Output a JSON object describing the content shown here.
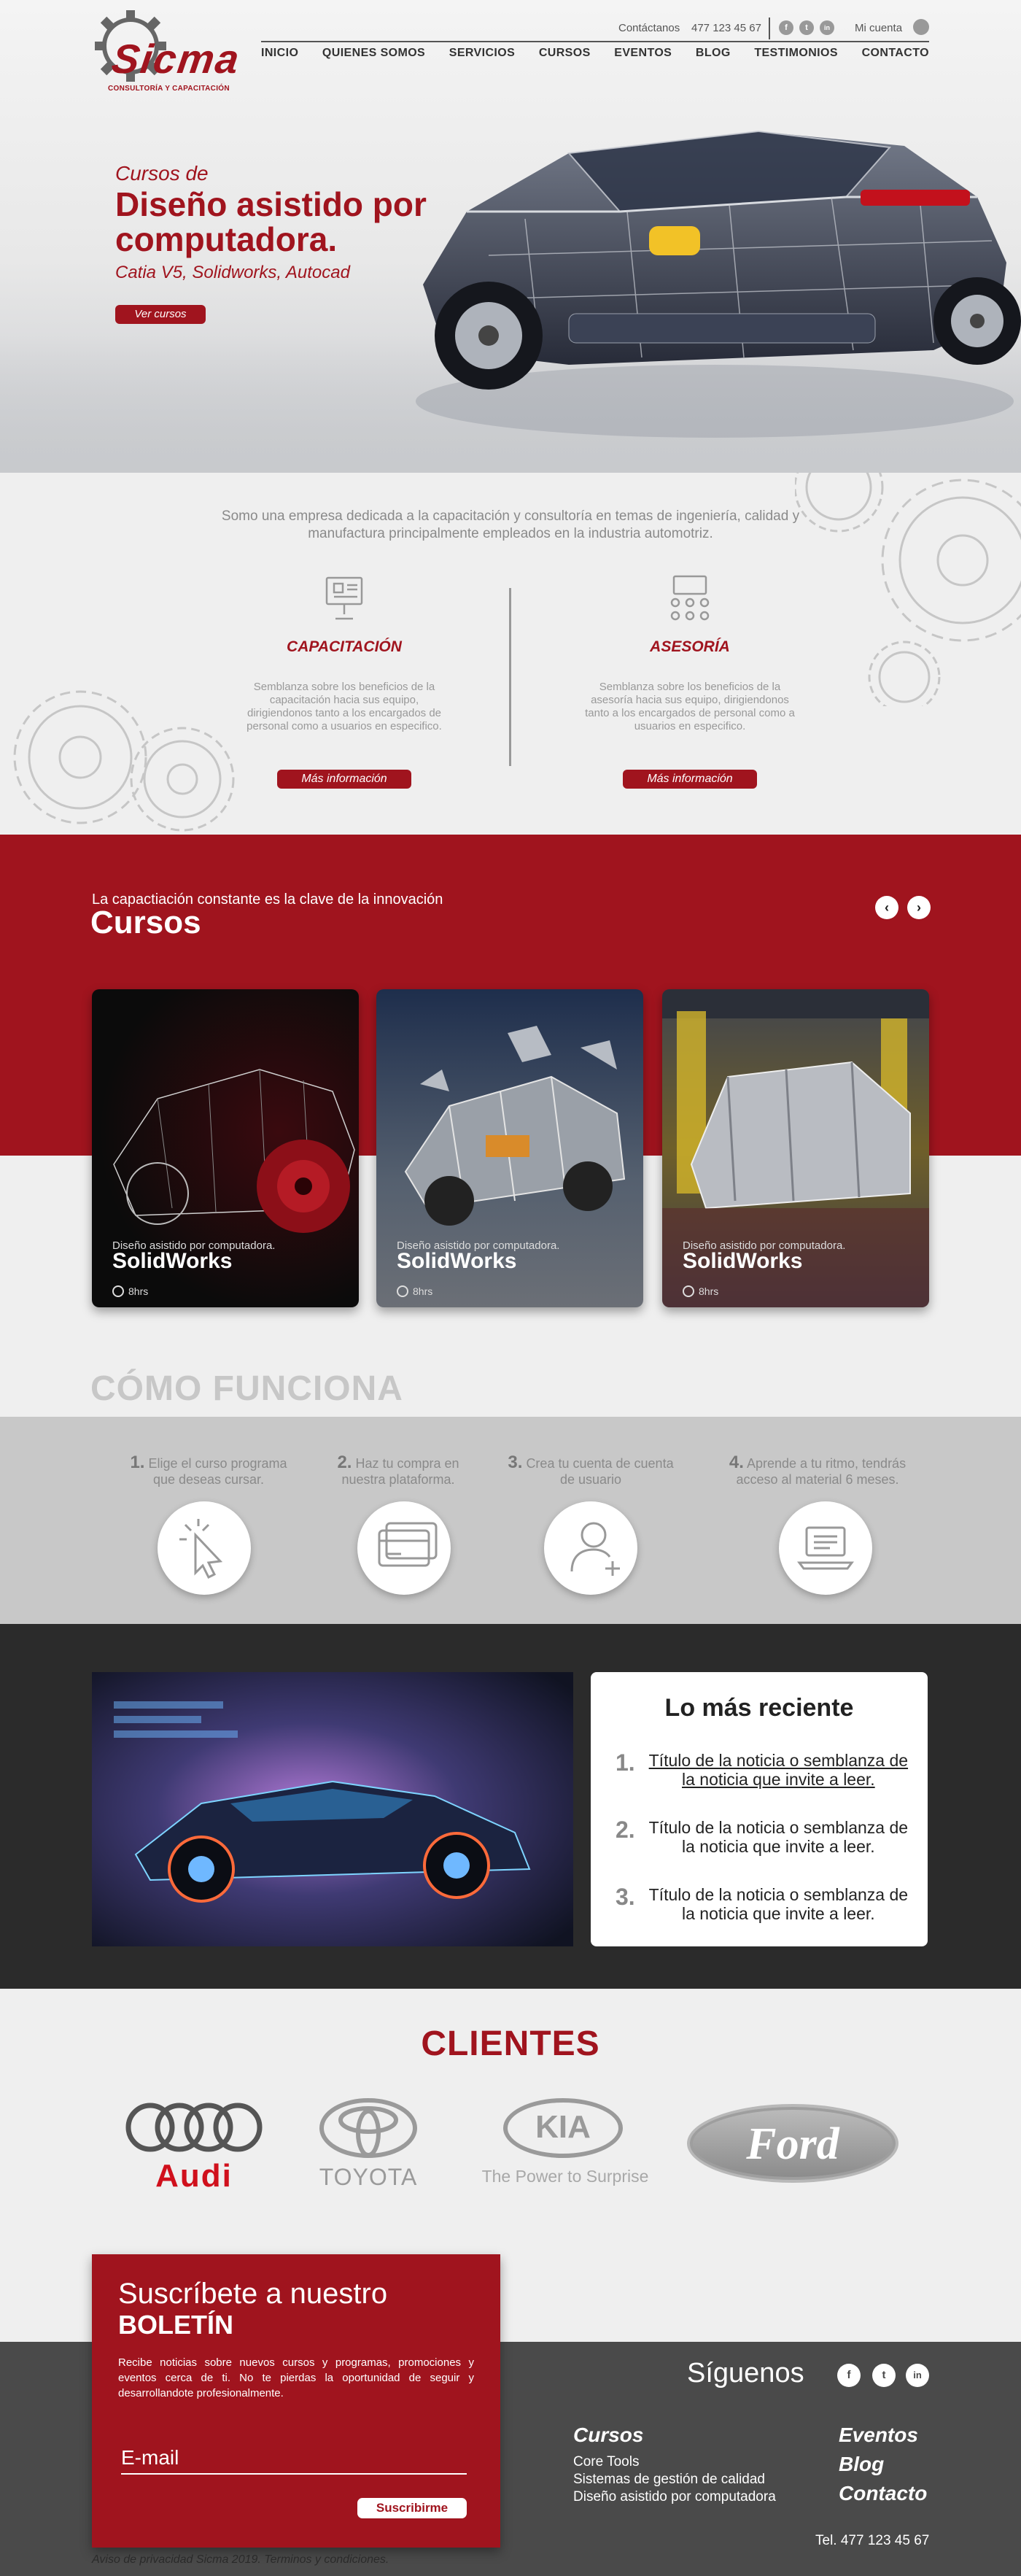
{
  "header": {
    "contact_label": "Contáctanos",
    "contact_phone": "477 123 45 67",
    "social": [
      "f",
      "t",
      "in"
    ],
    "account_label": "Mi cuenta",
    "logo_text": "Sicma",
    "logo_tagline": "CONSULTORÍA Y CAPACITACIÓN",
    "nav": [
      "INICIO",
      "QUIENES SOMOS",
      "SERVICIOS",
      "CURSOS",
      "EVENTOS",
      "BLOG",
      "TESTIMONIOS",
      "CONTACTO"
    ]
  },
  "hero": {
    "pretitle": "Cursos de",
    "title": "Diseño asistido por computadora.",
    "subtitle": "Catia V5, Solidworks, Autocad",
    "button": "Ver cursos"
  },
  "intro": {
    "text": "Somo una empresa dedicada a la capacitación y consultoría en temas de ingeniería, calidad y manufactura principalmente empleados en la industria automotriz.",
    "services": [
      {
        "title": "CAPACITACIÓN",
        "desc": "Semblanza sobre los beneficios de la capacitación hacia sus equipo, dirigiendonos tanto a los encargados de personal como a usuarios en especifico.",
        "button": "Más información"
      },
      {
        "title": "ASESORÍA",
        "desc": "Semblanza sobre los beneficios de la asesoría hacia sus equipo, dirigiendonos tanto a los encargados de personal como a usuarios en especifico.",
        "button": "Más información"
      }
    ]
  },
  "courses": {
    "pretitle": "La capactiación constante es la clave de la innovación",
    "title": "Cursos",
    "prev": "‹",
    "next": "›",
    "cards": [
      {
        "pre": "Diseño asistido por computadora.",
        "title": "SolidWorks",
        "hours": "8hrs"
      },
      {
        "pre": "Diseño asistido por computadora.",
        "title": "SolidWorks",
        "hours": "8hrs"
      },
      {
        "pre": "Diseño asistido por computadora.",
        "title": "SolidWorks",
        "hours": "8hrs"
      }
    ]
  },
  "how": {
    "title": "CÓMO FUNCIONA",
    "steps": [
      {
        "num": "1.",
        "line1": "Elige el curso programa",
        "line2": "que deseas cursar."
      },
      {
        "num": "2.",
        "line1": "Haz tu compra en",
        "line2": "nuestra plataforma."
      },
      {
        "num": "3.",
        "line1": "Crea tu cuenta de cuenta",
        "line2": "de usuario"
      },
      {
        "num": "4.",
        "line1": "Aprende a tu ritmo, tendrás",
        "line2": "acceso al material 6 meses."
      }
    ]
  },
  "recent": {
    "title": "Lo más reciente",
    "items": [
      {
        "num": "1.",
        "text": "Título de la noticia o semblanza de la noticia que invite a leer."
      },
      {
        "num": "2.",
        "text": "Título de la noticia o semblanza de la noticia que invite a leer."
      },
      {
        "num": "3.",
        "text": "Título de la noticia o semblanza de la noticia que invite a leer."
      }
    ]
  },
  "clients": {
    "title": "CLIENTES",
    "logos": [
      {
        "name": "Audi"
      },
      {
        "name": "TOYOTA"
      },
      {
        "name": "KIA",
        "tagline": "The Power to Surprise"
      },
      {
        "name": "Ford"
      }
    ]
  },
  "newsletter": {
    "line1": "Suscríbete a nuestro",
    "line2": "BOLETÍN",
    "desc": "Recibe noticias sobre nuevos cursos y programas, promociones y eventos cerca de ti. No te pierdas la oportunidad de seguir y desarrollandote profesionalmente.",
    "placeholder": "E-mail",
    "button": "Suscribirme"
  },
  "footer": {
    "follow": "Síguenos",
    "social": [
      "f",
      "t",
      "in"
    ],
    "courses_title": "Cursos",
    "courses": [
      "Core Tools",
      "Sistemas de gestión de calidad",
      "Diseño asistido por computadora"
    ],
    "links": [
      "Eventos",
      "Blog",
      "Contacto"
    ],
    "phone": "Tel. 477 123 45 67",
    "privacy": "Aviso de privacidad Sicma 2019. Terminos y condiciones."
  },
  "colors": {
    "brand": "#a0141e",
    "dark": "#2b2b2b",
    "footer": "#4a4a4a"
  }
}
